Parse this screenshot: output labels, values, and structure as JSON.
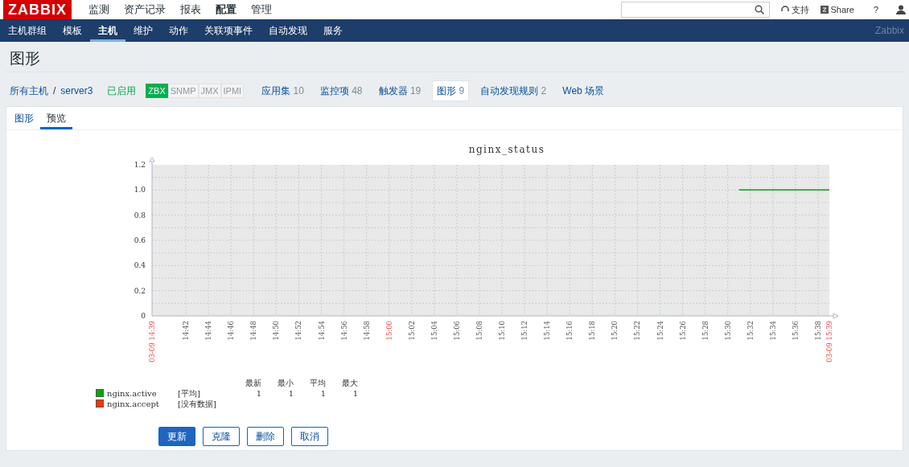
{
  "topbar": {
    "logo": "ZABBIX",
    "menu": [
      {
        "label": "监测",
        "selected": false
      },
      {
        "label": "资产记录",
        "selected": false
      },
      {
        "label": "报表",
        "selected": false
      },
      {
        "label": "配置",
        "selected": true
      },
      {
        "label": "管理",
        "selected": false
      }
    ],
    "support": "支持",
    "share": "Share",
    "help": "?"
  },
  "subnav": {
    "items": [
      {
        "label": "主机群组",
        "selected": false
      },
      {
        "label": "模板",
        "selected": false
      },
      {
        "label": "主机",
        "selected": true
      },
      {
        "label": "维护",
        "selected": false
      },
      {
        "label": "动作",
        "selected": false
      },
      {
        "label": "关联项事件",
        "selected": false
      },
      {
        "label": "自动发现",
        "selected": false
      },
      {
        "label": "服务",
        "selected": false
      }
    ],
    "brand": "Zabbix"
  },
  "page_title": "图形",
  "host_nav": {
    "breadcrumb": [
      "所有主机",
      "server3"
    ],
    "separator": "/",
    "status": "已启用",
    "interfaces": [
      {
        "label": "ZBX",
        "on": true
      },
      {
        "label": "SNMP",
        "on": false
      },
      {
        "label": "JMX",
        "on": false
      },
      {
        "label": "IPMI",
        "on": false
      }
    ],
    "links": [
      {
        "label": "应用集",
        "count": "10",
        "selected": false
      },
      {
        "label": "监控项",
        "count": "48",
        "selected": false
      },
      {
        "label": "触发器",
        "count": "19",
        "selected": false
      },
      {
        "label": "图形",
        "count": "9",
        "selected": true
      },
      {
        "label": "自动发现规则",
        "count": "2",
        "selected": false
      },
      {
        "label": "Web 场景",
        "selected": false
      }
    ]
  },
  "tabs": [
    {
      "label": "图形",
      "selected": false
    },
    {
      "label": "预览",
      "selected": true
    }
  ],
  "graph": {
    "chart_data": {
      "type": "line",
      "title": "nginx_status",
      "ylim": [
        0,
        1.2
      ],
      "grid": true,
      "categories": [
        "03-09 14:39",
        null,
        null,
        "14:42",
        null,
        "14:44",
        null,
        "14:46",
        null,
        "14:48",
        null,
        "14:50",
        null,
        "14:52",
        null,
        "14:54",
        null,
        "14:56",
        null,
        "14:58",
        null,
        "15:00",
        null,
        "15:02",
        null,
        "15:04",
        null,
        "15:06",
        null,
        "15:08",
        null,
        "15:10",
        null,
        "15:12",
        null,
        "15:14",
        null,
        "15:16",
        null,
        "15:18",
        null,
        "15:20",
        null,
        "15:22",
        null,
        "15:24",
        null,
        "15:26",
        null,
        "15:28",
        null,
        "15:30",
        null,
        "15:32",
        null,
        "15:34",
        null,
        "15:36",
        null,
        "15:38",
        "03-09 15:39"
      ],
      "yticks": [
        {
          "value": 0,
          "label": "0"
        },
        {
          "value": 0.2,
          "label": "0.2"
        },
        {
          "value": 0.4,
          "label": "0.4"
        },
        {
          "value": 0.6,
          "label": "0.6"
        },
        {
          "value": 0.8,
          "label": "0.8"
        },
        {
          "value": 1,
          "label": "1.0"
        },
        {
          "value": 1.2,
          "label": "1.2"
        }
      ],
      "series": [
        {
          "name": "nginx.active",
          "color": "#00aa00",
          "values": [
            null,
            null,
            null,
            null,
            null,
            null,
            null,
            null,
            null,
            null,
            null,
            null,
            null,
            null,
            null,
            null,
            null,
            null,
            null,
            null,
            null,
            null,
            null,
            null,
            null,
            null,
            null,
            null,
            null,
            null,
            null,
            null,
            null,
            null,
            null,
            null,
            null,
            null,
            null,
            null,
            null,
            null,
            null,
            null,
            null,
            null,
            null,
            null,
            null,
            null,
            null,
            null,
            1,
            1,
            1,
            1,
            1,
            1,
            1,
            1,
            1
          ]
        },
        {
          "name": "nginx.accept",
          "color": "#ff3300",
          "values": [
            null,
            null,
            null,
            null,
            null,
            null,
            null,
            null,
            null,
            null,
            null,
            null,
            null,
            null,
            null,
            null,
            null,
            null,
            null,
            null,
            null,
            null,
            null,
            null,
            null,
            null,
            null,
            null,
            null,
            null,
            null,
            null,
            null,
            null,
            null,
            null,
            null,
            null,
            null,
            null,
            null,
            null,
            null,
            null,
            null,
            null,
            null,
            null,
            null,
            null,
            null,
            null,
            null,
            null,
            null,
            null,
            null,
            null,
            null,
            null,
            null
          ]
        }
      ]
    },
    "legend": {
      "columns": [
        "最新",
        "最小",
        "平均",
        "最大"
      ],
      "rows": [
        {
          "function": "[平均]",
          "values": [
            "1",
            "1",
            "1",
            "1"
          ]
        },
        {
          "function": "[没有数据]"
        }
      ]
    }
  },
  "buttons": [
    {
      "label": "更新",
      "kind": "primary"
    },
    {
      "label": "克隆",
      "kind": "outline"
    },
    {
      "label": "删除",
      "kind": "outline"
    },
    {
      "label": "取消",
      "kind": "outline"
    }
  ]
}
